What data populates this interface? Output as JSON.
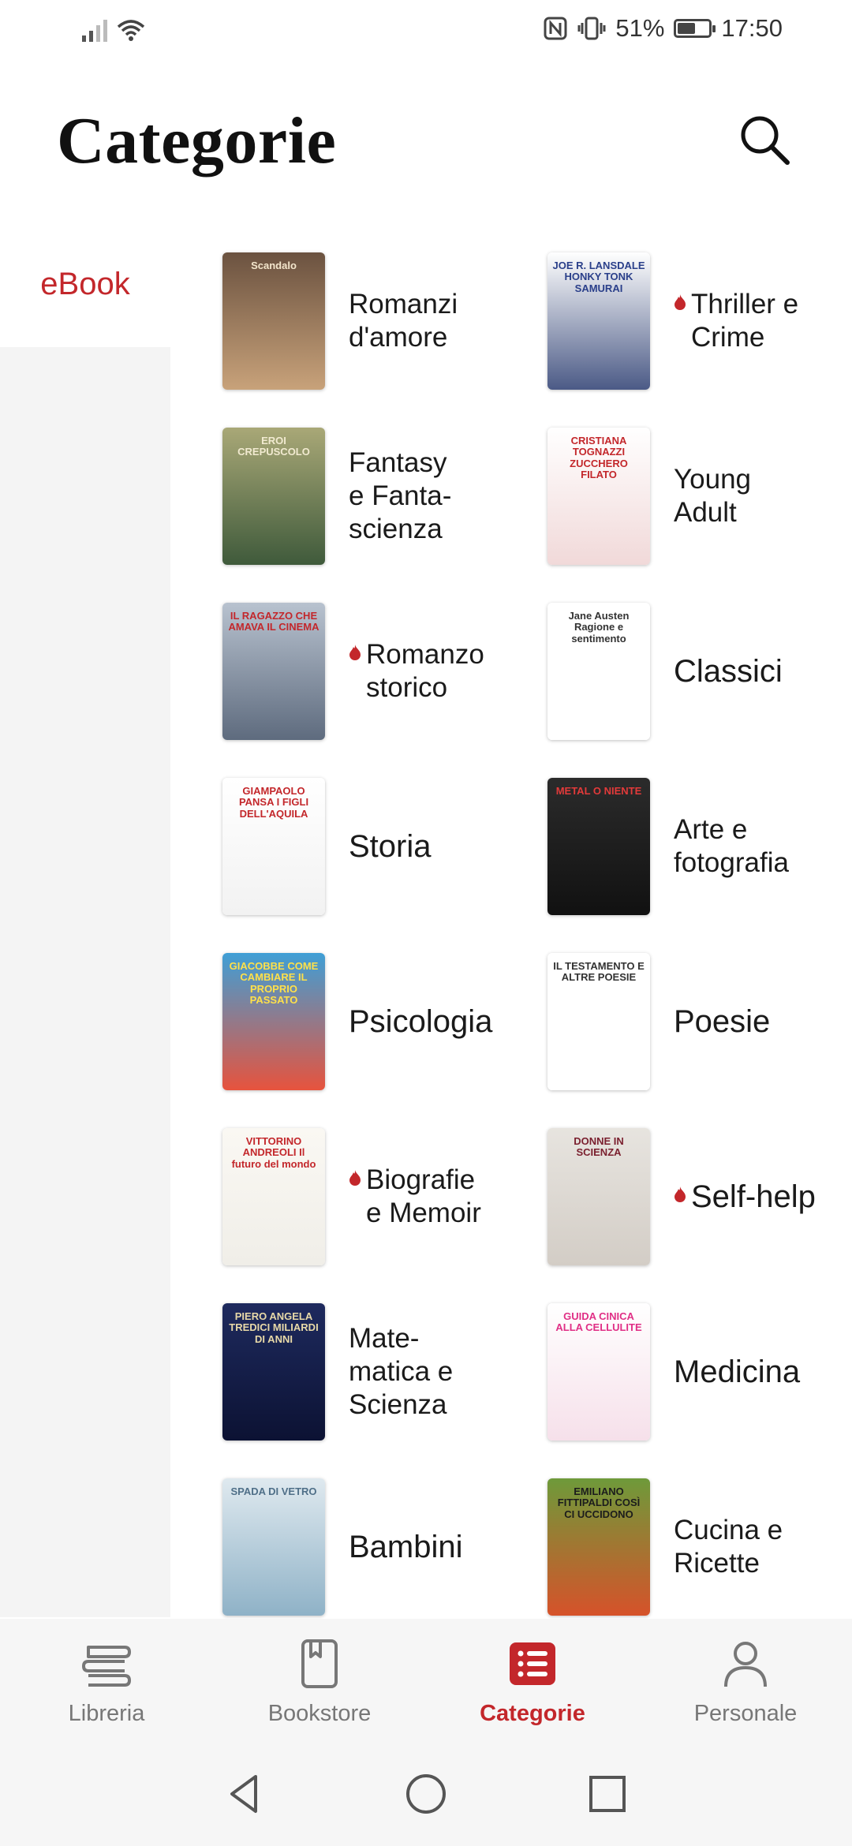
{
  "status_bar": {
    "battery": "51%",
    "time": "17:50"
  },
  "header": {
    "title": "Categorie"
  },
  "sidebar": {
    "items": [
      {
        "label": "eBook"
      }
    ]
  },
  "categories": [
    {
      "label": "Romanzi\nd'amore",
      "hot": false,
      "cover_text": "Scandalo",
      "cover_colors": [
        "#6b5240",
        "#c8a27a"
      ],
      "text_color": "#f3e6cc"
    },
    {
      "label": "Thriller e\nCrime",
      "hot": true,
      "cover_text": "JOE R. LANSDALE HONKY TONK SAMURAI",
      "cover_colors": [
        "#ffffff",
        "#4b5a86"
      ],
      "text_color": "#2a3f8a"
    },
    {
      "label": "Fantasy\ne Fanta-\nscienza",
      "hot": false,
      "cover_text": "EROI CREPUSCOLO",
      "cover_colors": [
        "#a9a877",
        "#3f5a3b"
      ],
      "text_color": "#f1ead0"
    },
    {
      "label": "Young\nAdult",
      "hot": false,
      "cover_text": "CRISTIANA TOGNAZZI ZUCCHERO FILATO",
      "cover_colors": [
        "#ffffff",
        "#f1d9d9"
      ],
      "text_color": "#c3272b"
    },
    {
      "label": "Romanzo\nstorico",
      "hot": true,
      "cover_text": "IL RAGAZZO CHE AMAVA IL CINEMA",
      "cover_colors": [
        "#b8c2cf",
        "#5e6b7e"
      ],
      "text_color": "#c3272b"
    },
    {
      "label": "Classici",
      "hot": false,
      "cover_text": "Jane Austen Ragione e sentimento",
      "cover_colors": [
        "#ffffff",
        "#ffffff"
      ],
      "text_color": "#333333"
    },
    {
      "label": "Storia",
      "hot": false,
      "cover_text": "GIAMPAOLO PANSA I FIGLI DELL'AQUILA",
      "cover_colors": [
        "#ffffff",
        "#f2f2f2"
      ],
      "text_color": "#c3272b"
    },
    {
      "label": "Arte e\nfotografia",
      "hot": false,
      "cover_text": "METAL O NIENTE",
      "cover_colors": [
        "#2b2b2b",
        "#111111"
      ],
      "text_color": "#e23a3a"
    },
    {
      "label": "Psicologia",
      "hot": false,
      "cover_text": "GIACOBBE COME CAMBIARE IL PROPRIO PASSATO",
      "cover_colors": [
        "#3f9fd6",
        "#e7533d"
      ],
      "text_color": "#ffe14a"
    },
    {
      "label": "Poesie",
      "hot": false,
      "cover_text": "IL TESTAMENTO E ALTRE POESIE",
      "cover_colors": [
        "#ffffff",
        "#ffffff"
      ],
      "text_color": "#333333"
    },
    {
      "label": "Biografie\ne Memoir",
      "hot": true,
      "cover_text": "VITTORINO ANDREOLI Il futuro del mondo",
      "cover_colors": [
        "#faf8f3",
        "#f0eee8"
      ],
      "text_color": "#c3272b"
    },
    {
      "label": "Self-help",
      "hot": true,
      "cover_text": "DONNE IN SCIENZA",
      "cover_colors": [
        "#e7e4df",
        "#d3cdc6"
      ],
      "text_color": "#7a1f2e"
    },
    {
      "label": "Mate-\nmatica e\nScienza",
      "hot": false,
      "cover_text": "PIERO ANGELA TREDICI MILIARDI DI ANNI",
      "cover_colors": [
        "#1e2a5e",
        "#0c1233"
      ],
      "text_color": "#e8d9a8"
    },
    {
      "label": "Medicina",
      "hot": false,
      "cover_text": "GUIDA CINICA ALLA CELLULITE",
      "cover_colors": [
        "#ffffff",
        "#f6e0ea"
      ],
      "text_color": "#e02f86"
    },
    {
      "label": "Bambini",
      "hot": false,
      "cover_text": "SPADA DI VETRO",
      "cover_colors": [
        "#dfe9ef",
        "#8fb2c7"
      ],
      "text_color": "#4f6f88"
    },
    {
      "label": "Cucina e\nRicette",
      "hot": false,
      "cover_text": "EMILIANO FITTIPALDI COSÌ CI UCCIDONO",
      "cover_colors": [
        "#6e9a3a",
        "#d6522a"
      ],
      "text_color": "#1c1c1c"
    }
  ],
  "bottom_nav": [
    {
      "label": "Libreria",
      "icon": "library-icon",
      "active": false
    },
    {
      "label": "Bookstore",
      "icon": "book-icon",
      "active": false
    },
    {
      "label": "Categorie",
      "icon": "categories-icon",
      "active": true
    },
    {
      "label": "Personale",
      "icon": "person-icon",
      "active": false
    }
  ],
  "colors": {
    "accent": "#c3272b",
    "sidebar_bg": "#f4f4f4",
    "nav_bg": "#f6f6f6"
  }
}
